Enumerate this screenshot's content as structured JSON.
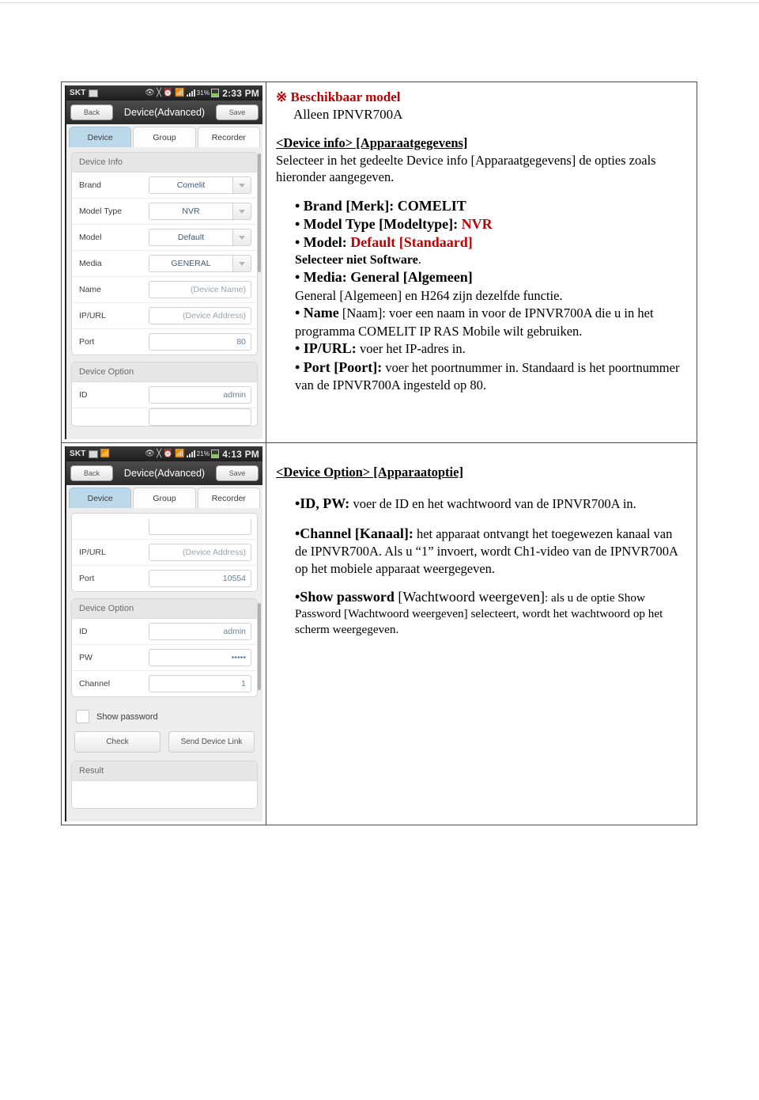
{
  "document": {
    "rows": [
      {
        "screenshot": {
          "name": "device-info-screen",
          "statusbar": {
            "carrier": "SKT",
            "icons": [
              "picture-icon",
              "eye-off-icon",
              "mute-icon",
              "alarm-icon",
              "wifi-icon",
              "signal-bars-icon"
            ],
            "battery_pct": "31%",
            "clock": "2:33 PM"
          },
          "navbar": {
            "back": "Back",
            "title": "Device(Advanced)",
            "save": "Save"
          },
          "tabs": [
            {
              "label": "Device",
              "active": true
            },
            {
              "label": "Group",
              "active": false
            },
            {
              "label": "Recorder",
              "active": false
            }
          ],
          "cards": [
            {
              "title": "Device Info",
              "rows": [
                {
                  "label": "Brand",
                  "value": "Comelit",
                  "kind": "select"
                },
                {
                  "label": "Model Type",
                  "value": "NVR",
                  "kind": "select"
                },
                {
                  "label": "Model",
                  "value": "Default",
                  "kind": "select"
                },
                {
                  "label": "Media",
                  "value": "GENERAL",
                  "kind": "select"
                },
                {
                  "label": "Name",
                  "value": "(Device Name)",
                  "kind": "placeholder"
                },
                {
                  "label": "IP/URL",
                  "value": "(Device Address)",
                  "kind": "placeholder"
                },
                {
                  "label": "Port",
                  "value": "80",
                  "kind": "value"
                }
              ]
            },
            {
              "title": "Device Option",
              "rows": [
                {
                  "label": "ID",
                  "value": "admin",
                  "kind": "value"
                }
              ]
            }
          ]
        },
        "text": {
          "heading_marker": "※",
          "heading": "Beschikbaar model",
          "heading_sub": "Alleen IPNVR700A",
          "section_title": "<Device info> [Apparaatgegevens]",
          "section_intro": "Selecteer in het gedeelte Device info [Apparaatgegevens] de opties zoals hieronder aangegeven.",
          "bullets": [
            {
              "bold": "• Brand [Merk]: COMELIT"
            },
            {
              "bold": "• Model Type [Modeltype]: ",
              "red": "NVR"
            },
            {
              "bold": "• Model: ",
              "red": "Default [Standaard]"
            },
            {
              "note_bold": "Selecteer niet Software",
              "note_tail": "."
            },
            {
              "bold": "• Media: General [Algemeen]"
            },
            {
              "note": "General [Algemeen] en H264 zijn dezelfde functie."
            },
            {
              "lead": "• Name",
              "tail": " [Naam]: voer een naam in voor de IPNVR700A die u in het programma COMELIT IP RAS Mobile wilt gebruiken."
            },
            {
              "lead": "• IP/URL:",
              "tail": " voer het IP-adres in."
            },
            {
              "lead": "• Port [Poort]:",
              "tail": " voer het poortnummer in. Standaard is het poortnummer van de IPNVR700A ingesteld op 80."
            }
          ]
        }
      },
      {
        "screenshot": {
          "name": "device-option-screen",
          "statusbar": {
            "carrier": "SKT",
            "icons": [
              "picture-icon",
              "bluetooth-icon",
              "eye-off-icon",
              "mute-icon",
              "alarm-icon",
              "wifi-icon",
              "signal-bars-icon"
            ],
            "battery_pct": "21%",
            "clock": "4:13 PM"
          },
          "navbar": {
            "back": "Back",
            "title": "Device(Advanced)",
            "save": "Save"
          },
          "tabs": [
            {
              "label": "Device",
              "active": true
            },
            {
              "label": "Group",
              "active": false
            },
            {
              "label": "Recorder",
              "active": false
            }
          ],
          "cards": [
            {
              "title": null,
              "rows": [
                {
                  "label": "IP/URL",
                  "value": "(Device Address)",
                  "kind": "placeholder"
                },
                {
                  "label": "Port",
                  "value": "10554",
                  "kind": "value"
                }
              ]
            },
            {
              "title": "Device Option",
              "rows": [
                {
                  "label": "ID",
                  "value": "admin",
                  "kind": "value"
                },
                {
                  "label": "PW",
                  "value": "•••••",
                  "kind": "value"
                },
                {
                  "label": "Channel",
                  "value": "1",
                  "kind": "value"
                }
              ]
            }
          ],
          "checkbox": {
            "label": "Show password",
            "checked": false
          },
          "buttons": [
            "Check",
            "Send Device Link"
          ],
          "result": {
            "title": "Result",
            "value": ""
          }
        },
        "text": {
          "section_title": "<Device Option> [Apparaatoptie]",
          "bullets": [
            {
              "lead": "•ID, PW:",
              "tail": " voer de ID en het wachtwoord van de IPNVR700A in."
            },
            {
              "lead": "•Channel [Kanaal]:",
              "tail": " het apparaat ontvangt het toegewezen kanaal van de IPNVR700A. Als u “1” invoert, wordt Ch1-video van de IPNVR700A op het mobiele apparaat weergegeven."
            },
            {
              "lead": "•Show password",
              "mid": " [Wachtwoord weergeven]",
              "tail": ": als u de optie Show Password [Wachtwoord weergeven] selecteert, wordt het wachtwoord op het scherm weergegeven."
            }
          ]
        }
      }
    ]
  },
  "colors": {
    "accent_red": "#c00000",
    "tab_active": "#bcd9ec",
    "field_text": "#6d7f91"
  }
}
